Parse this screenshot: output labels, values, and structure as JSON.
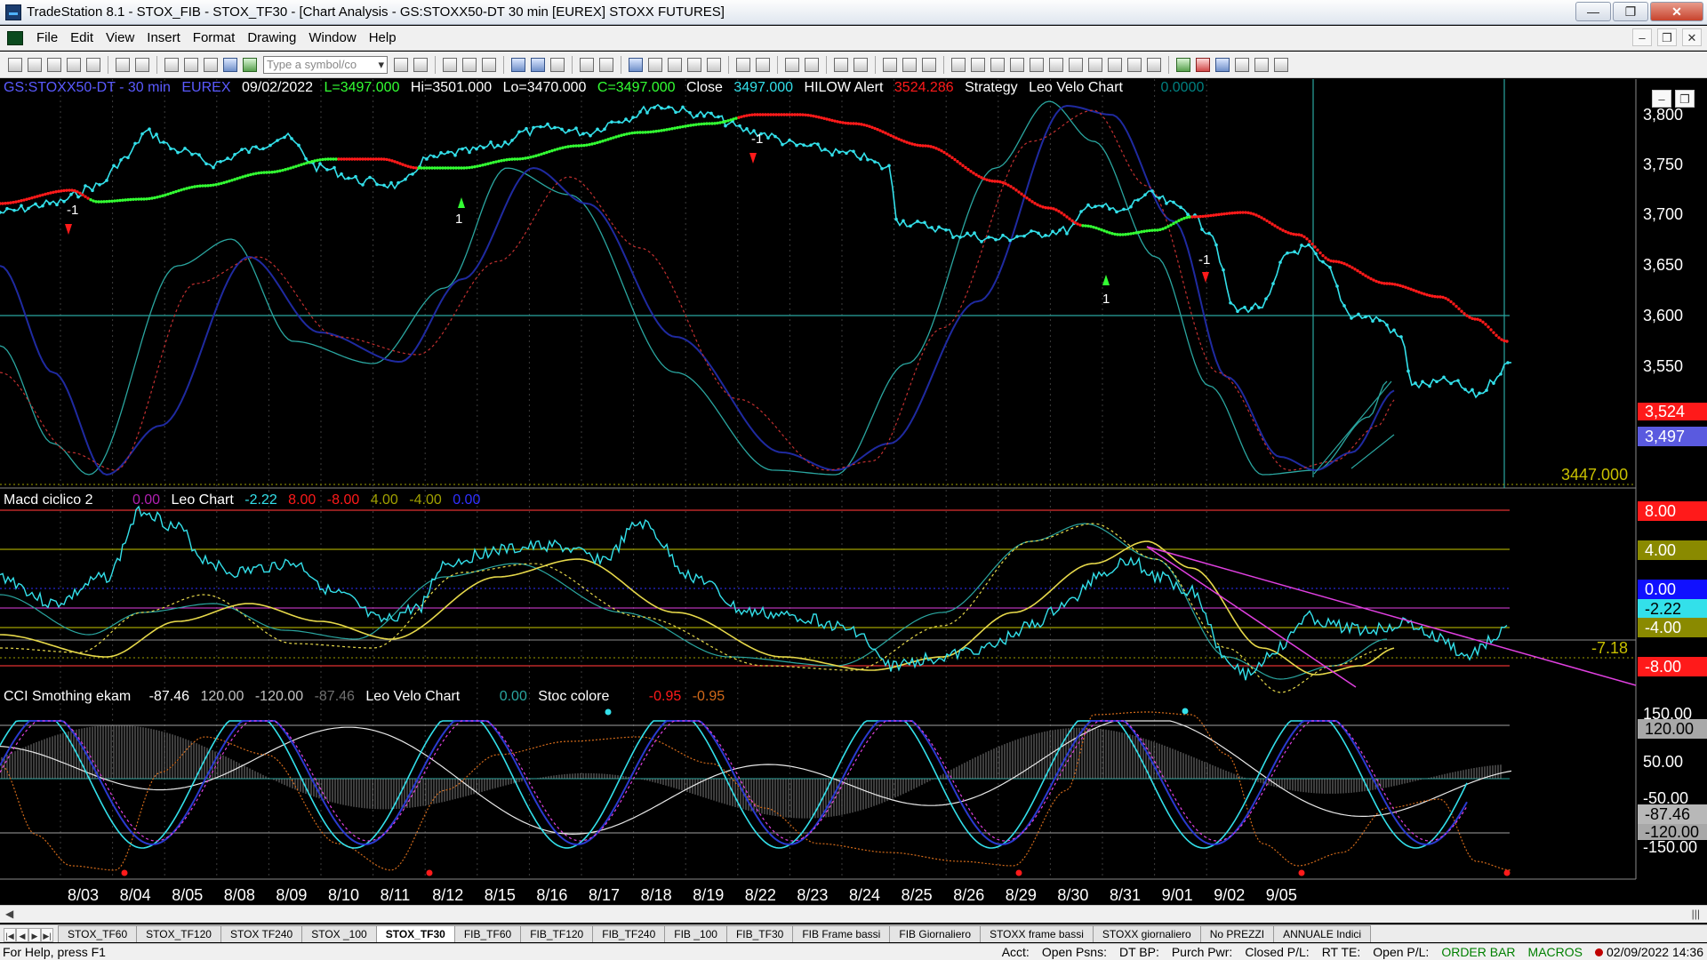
{
  "window": {
    "title": "TradeStation 8.1 - STOX_FIB - STOX_TF30 - [Chart Analysis - GS:STOXX50-DT  30 min  [EUREX] STOXX FUTURES]",
    "controls": {
      "minimize": "—",
      "maximize": "❐",
      "close": "✕"
    }
  },
  "menu": {
    "items": [
      "File",
      "Edit",
      "View",
      "Insert",
      "Format",
      "Drawing",
      "Window",
      "Help"
    ],
    "mdi": {
      "minimize": "–",
      "restore": "❐",
      "close": "✕"
    }
  },
  "toolbar": {
    "symbol_placeholder": "Type a symbol/co"
  },
  "chart": {
    "header": {
      "symbol": "GS:STOXX50-DT - 30 min",
      "exchange": "EUREX",
      "date": "09/02/2022",
      "last": "L=3497.000",
      "high": "Hi=3501.000",
      "low": "Lo=3470.000",
      "close_eq": "C=3497.000",
      "close_label": "Close",
      "close_value": "3497.000",
      "hilow": "HILOW Alert",
      "hilow_value": "3524.286",
      "strategy": "Strategy",
      "leo_velo": "Leo Velo Chart",
      "leo_velo_value": "0.0000"
    },
    "panel2_header": {
      "name": "Macd ciclico 2",
      "v1": "0.00",
      "leo": "Leo Chart",
      "v2": "-2.22",
      "v3": "8.00",
      "v4": "-8.00",
      "v5": "4.00",
      "v6": "-4.00",
      "v7": "0.00"
    },
    "panel3_header": {
      "name": "CCI Smothing ekam",
      "v1": "-87.46",
      "v2": "120.00",
      "v3": "-120.00",
      "v4": "-87.46",
      "leo": "Leo Velo Chart",
      "v5": "0.00",
      "stoc": "Stoc colore",
      "v6": "-0.95",
      "v7": "-0.95"
    },
    "signals": {
      "sell": "-1",
      "buy": "1"
    },
    "price_axis": [
      "3,800",
      "3,750",
      "3,700",
      "3,650",
      "3,600",
      "3,550"
    ],
    "price_badges": {
      "red": "3,524",
      "blue": "3,497"
    },
    "price_level": "3447.000",
    "macd_axis": {
      "p8": "8.00",
      "p4": "4.00",
      "zero": "0.00",
      "cur": "-2.22",
      "m4": "-4.00",
      "m8": "-8.00",
      "level": "-7.18"
    },
    "cci_axis": {
      "p150": "150.00",
      "p120": "120.00",
      "p50": "50.00",
      "m50": "-50.00",
      "cur": "-87.46",
      "m120": "-120.00",
      "m150": "-150.00"
    },
    "dates": [
      "8/03",
      "8/04",
      "8/05",
      "8/08",
      "8/09",
      "8/10",
      "8/11",
      "8/12",
      "8/15",
      "8/16",
      "8/17",
      "8/18",
      "8/19",
      "8/22",
      "8/23",
      "8/24",
      "8/25",
      "8/26",
      "8/29",
      "8/30",
      "8/31",
      "9/01",
      "9/02",
      "9/05"
    ]
  },
  "tabs": [
    "STOX_TF60",
    "STOX_TF120",
    "STOX TF240",
    "STOX _100",
    "STOX_TF30",
    "FIB_TF60",
    "FIB_TF120",
    "FIB_TF240",
    "FIB _100",
    "FIB_TF30",
    "FIB Frame bassi",
    "FIB Giornaliero",
    "STOXX frame bassi",
    "STOXX giornaliero",
    "No PREZZI",
    "ANNUALE Indici"
  ],
  "active_tab": "STOX_TF30",
  "status": {
    "help": "For Help, press F1",
    "acct": "Acct:",
    "open_psns": "Open Psns:",
    "dt_bp": "DT BP:",
    "purch_pwr": "Purch Pwr:",
    "closed_pl": "Closed P/L:",
    "rt_te": "RT TE:",
    "open_pl": "Open P/L:",
    "order_bar": "ORDER BAR",
    "macros": "MACROS",
    "datetime": "02/09/2022 14:36"
  },
  "colors": {
    "cyan": "#33e0ea",
    "red": "#ff1a1a",
    "green": "#33ff33",
    "navy": "#1f2aa0",
    "teal": "#2aa6a0",
    "yellow": "#e6d84a",
    "magenta": "#e040e0",
    "olive": "#a0a000"
  }
}
